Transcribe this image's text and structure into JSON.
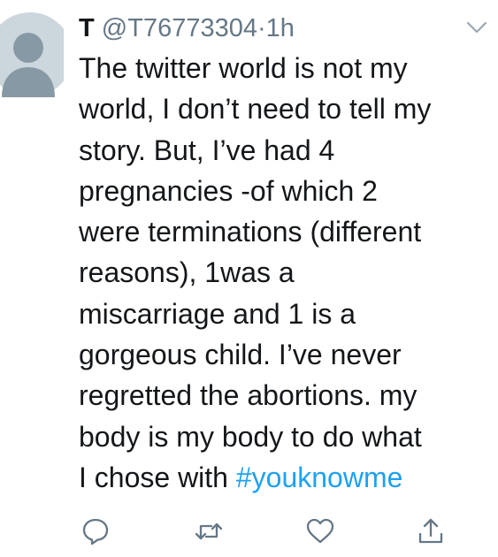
{
  "tweet": {
    "author_name": "T",
    "handle": "@T76773304",
    "separator": "·",
    "time": "1h",
    "text_lines": [
      "The twitter world is not my",
      "world, I don’t need to tell my",
      "story. But, I’ve had 4",
      "pregnancies -of which 2",
      "were terminations (different",
      "reasons), 1was a",
      "miscarriage and 1 is a",
      "gorgeous child. I’ve never",
      "regretted the abortions. my",
      "body is my body to do what"
    ],
    "last_line_text": "I chose with ",
    "hashtag": "#youknowme"
  },
  "icons": {
    "avatar": "default-avatar-icon",
    "caret": "chevron-down-icon",
    "reply": "reply-icon",
    "retweet": "retweet-icon",
    "like": "heart-icon",
    "share": "share-icon"
  },
  "colors": {
    "text": "#14171a",
    "secondary": "#657786",
    "link": "#1da1f2",
    "icon": "#657786",
    "avatar_bg": "#ccd6dd",
    "avatar_fg": "#8899a6"
  }
}
